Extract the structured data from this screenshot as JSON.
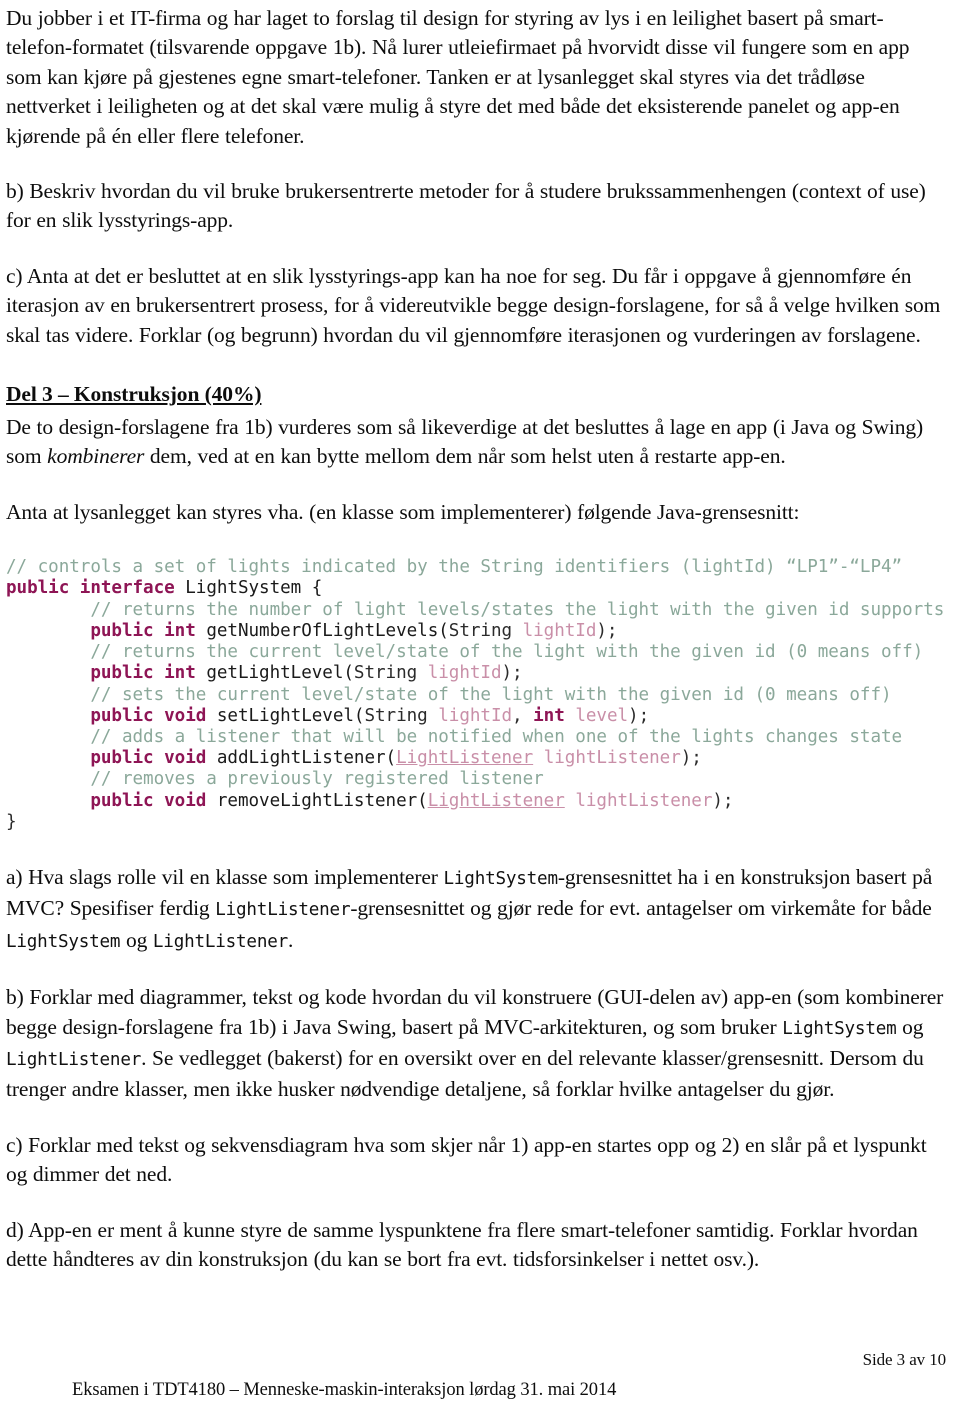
{
  "document": {
    "language": "no",
    "paragraphs": {
      "intro": "Du jobber i et IT-firma og har laget to forslag til design for styring av lys i en leilighet basert på smart-telefon-formatet (tilsvarende oppgave 1b). Nå lurer utleiefirmaet på hvorvidt disse vil fungere som en app som kan kjøre på gjestenes egne smart-telefoner. Tanken er at lysanlegget skal styres via det trådløse nettverket i leiligheten og at det skal være mulig å styre det med både det eksisterende panelet og app-en kjørende på én eller flere telefoner.",
      "task_b_upper": "b) Beskriv hvordan du vil bruke brukersentrerte metoder for å studere brukssammenhengen (context of use) for en slik lysstyrings-app.",
      "task_c_upper": "c) Anta at det er besluttet at en slik lysstyrings-app kan ha noe for seg. Du får i oppgave å gjennomføre én iterasjon av en brukersentrert prosess, for å videreutvikle begge design-forslagene, for så å velge hvilken som skal tas videre. Forklar (og begrunn) hvordan du vil gjennomføre iterasjonen og vurderingen av forslagene.",
      "del3_lead_1": "De to design-forslagene fra 1b) vurderes som så likeverdige at det besluttes å lage en app (i Java og Swing) som ",
      "del3_lead_italic": "kombinerer",
      "del3_lead_2": " dem, ved at en kan bytte mellom dem når som helst uten å restarte app-en.",
      "del3_lead_3": "Anta at lysanlegget kan styres vha. (en klasse som implementerer) følgende Java-grensesnitt:",
      "task_a_lower_1": "a) Hva slags rolle vil en klasse som implementerer ",
      "task_a_lower_code1": "LightSystem",
      "task_a_lower_2": "-grensesnittet ha i en konstruksjon basert på MVC? Spesifiser ferdig ",
      "task_a_lower_code2": "LightListener",
      "task_a_lower_3": "-grensesnittet og gjør rede for evt. antagelser om virkemåte for både ",
      "task_a_lower_code3": "LightSystem",
      "task_a_lower_4": " og ",
      "task_a_lower_code4": "LightListener",
      "task_a_lower_5": ".",
      "task_b_lower_1": "b) Forklar med diagrammer, tekst og kode hvordan du vil konstruere (GUI-delen av) app-en (som kombinerer begge design-forslagene fra 1b) i Java Swing, basert på MVC-arkitekturen, og som bruker ",
      "task_b_lower_code1": "LightSystem",
      "task_b_lower_2": " og ",
      "task_b_lower_code2": "LightListener",
      "task_b_lower_3": ". Se vedlegget (bakerst) for en oversikt over en del relevante klasser/grensesnitt. Dersom du trenger andre klasser, men ikke husker nødvendige detaljene, så forklar hvilke antagelser du gjør.",
      "task_c_lower": "c) Forklar med tekst og sekvensdiagram hva som skjer når 1) app-en startes opp og 2) en slår på et lyspunkt og dimmer det ned.",
      "task_d_lower": "d) App-en er ment å kunne styre de samme lyspunktene fra flere smart-telefoner samtidig. Forklar hvordan dette håndteres av din konstruksjon (du kan se bort fra evt. tidsforsinkelser i nettet osv.)."
    },
    "section_heading": "Del 3 – Konstruksjon (40%)",
    "code_block": {
      "language": "java",
      "lines": [
        {
          "indent": 0,
          "tokens": [
            {
              "t": "comment",
              "v": "// controls a set of lights indicated by the String identifiers (lightId) “LP1”-“LP4”"
            }
          ]
        },
        {
          "indent": 0,
          "tokens": [
            {
              "t": "kw",
              "v": "public interface "
            },
            {
              "t": "id",
              "v": "LightSystem {"
            }
          ]
        },
        {
          "indent": 1,
          "tokens": [
            {
              "t": "comment",
              "v": "// returns the number of light levels/states the light with the given id supports"
            }
          ]
        },
        {
          "indent": 1,
          "tokens": [
            {
              "t": "kw",
              "v": "public int "
            },
            {
              "t": "id",
              "v": "getNumberOfLightLevels("
            },
            {
              "t": "type",
              "v": "String "
            },
            {
              "t": "param",
              "v": "lightId"
            },
            {
              "t": "punct",
              "v": ");"
            }
          ]
        },
        {
          "indent": 1,
          "tokens": [
            {
              "t": "comment",
              "v": "// returns the current level/state of the light with the given id (0 means off)"
            }
          ]
        },
        {
          "indent": 1,
          "tokens": [
            {
              "t": "kw",
              "v": "public int "
            },
            {
              "t": "id",
              "v": "getLightLevel("
            },
            {
              "t": "type",
              "v": "String "
            },
            {
              "t": "param",
              "v": "lightId"
            },
            {
              "t": "punct",
              "v": ");"
            }
          ]
        },
        {
          "indent": 1,
          "tokens": [
            {
              "t": "comment",
              "v": "// sets the current level/state of the light with the given id (0 means off)"
            }
          ]
        },
        {
          "indent": 1,
          "tokens": [
            {
              "t": "kw",
              "v": "public void "
            },
            {
              "t": "id",
              "v": "setLightLevel("
            },
            {
              "t": "type",
              "v": "String "
            },
            {
              "t": "param",
              "v": "lightId"
            },
            {
              "t": "punct",
              "v": ", "
            },
            {
              "t": "kw",
              "v": "int "
            },
            {
              "t": "param",
              "v": "level"
            },
            {
              "t": "punct",
              "v": ");"
            }
          ]
        },
        {
          "indent": 1,
          "tokens": [
            {
              "t": "comment",
              "v": "// adds a listener that will be notified when one of the lights changes state"
            }
          ]
        },
        {
          "indent": 1,
          "tokens": [
            {
              "t": "kw",
              "v": "public void "
            },
            {
              "t": "id",
              "v": "addLightListener("
            },
            {
              "t": "link",
              "v": "LightListener"
            },
            {
              "t": "punct",
              "v": " "
            },
            {
              "t": "param",
              "v": "lightListener"
            },
            {
              "t": "punct",
              "v": ");"
            }
          ]
        },
        {
          "indent": 1,
          "tokens": [
            {
              "t": "comment",
              "v": "// removes a previously registered listener"
            }
          ]
        },
        {
          "indent": 1,
          "tokens": [
            {
              "t": "kw",
              "v": "public void "
            },
            {
              "t": "id",
              "v": "removeLightListener("
            },
            {
              "t": "link",
              "v": "LightListener"
            },
            {
              "t": "punct",
              "v": " "
            },
            {
              "t": "param",
              "v": "lightListener"
            },
            {
              "t": "punct",
              "v": ");"
            }
          ]
        },
        {
          "indent": 0,
          "tokens": [
            {
              "t": "punct",
              "v": "}"
            }
          ]
        }
      ]
    },
    "footer": {
      "page_number": "Side 3 av 10",
      "footer_text": "Eksamen i TDT4180 – Menneske-maskin-interaksjon lørdag 31. mai 2014"
    },
    "colors": {
      "comment": "#8ba89a",
      "keyword": "#8e1555",
      "identifier": "#1a1a1a",
      "parameter": "#c98fa8",
      "body_text": "#0d0d0d",
      "background": "#ffffff"
    }
  }
}
